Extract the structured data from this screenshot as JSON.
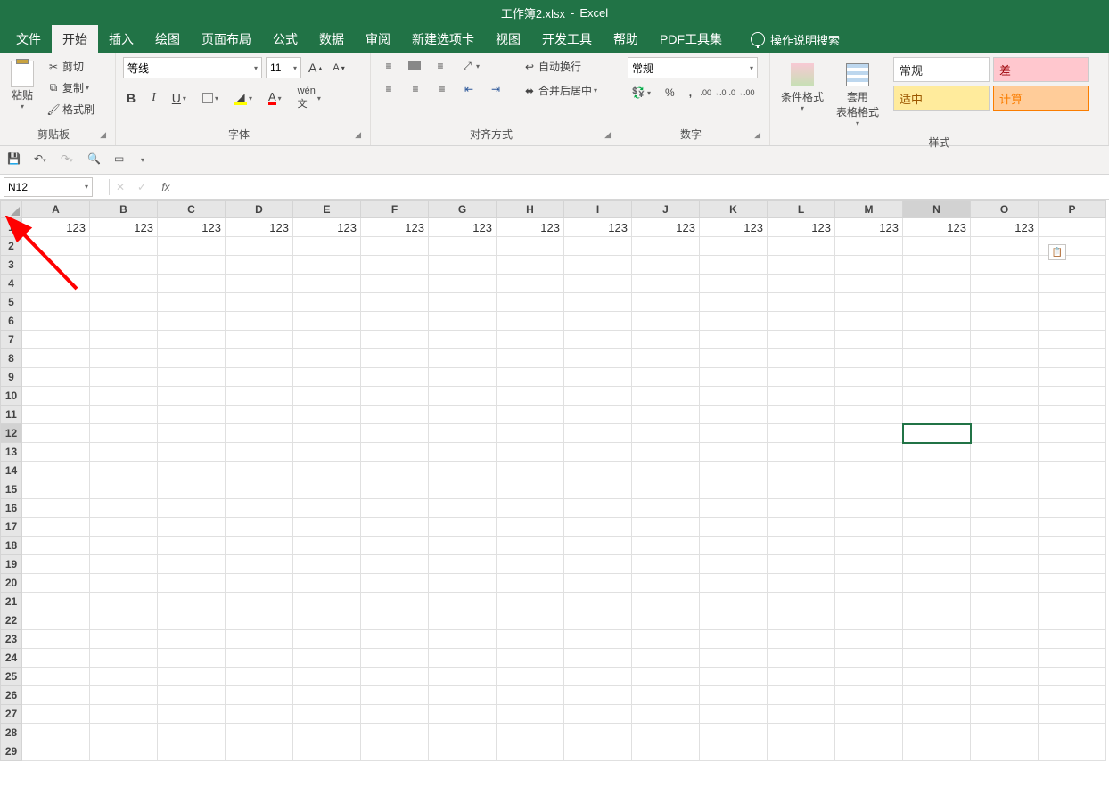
{
  "title": {
    "filename": "工作簿2.xlsx",
    "sep": "-",
    "app": "Excel"
  },
  "tabs": [
    "文件",
    "开始",
    "插入",
    "绘图",
    "页面布局",
    "公式",
    "数据",
    "审阅",
    "新建选项卡",
    "视图",
    "开发工具",
    "帮助",
    "PDF工具集"
  ],
  "active_tab_index": 1,
  "tellme": "操作说明搜索",
  "clipboard": {
    "paste": "粘贴",
    "cut": "剪切",
    "copy": "复制",
    "fmtpaint": "格式刷",
    "group": "剪贴板"
  },
  "font": {
    "name": "等线",
    "size": "11",
    "group": "字体"
  },
  "align": {
    "wrap": "自动换行",
    "merge": "合并后居中",
    "group": "对齐方式"
  },
  "number": {
    "format": "常规",
    "group": "数字"
  },
  "styles": {
    "condfmt": "条件格式",
    "tablefmt": "套用\n表格格式",
    "group": "样式",
    "cells": {
      "normal": "常规",
      "bad": "差",
      "good": "适中",
      "calc": "计算"
    }
  },
  "namebox": "N12",
  "columns": [
    "A",
    "B",
    "C",
    "D",
    "E",
    "F",
    "G",
    "H",
    "I",
    "J",
    "K",
    "L",
    "M",
    "N",
    "O",
    "P"
  ],
  "rows": [
    1,
    2,
    3,
    4,
    5,
    6,
    7,
    8,
    9,
    10,
    11,
    12,
    13,
    14,
    15,
    16,
    17,
    18,
    19,
    20,
    21,
    22,
    23,
    24,
    25,
    26,
    27,
    28,
    29
  ],
  "row1_values": [
    "123",
    "123",
    "123",
    "123",
    "123",
    "123",
    "123",
    "123",
    "123",
    "123",
    "123",
    "123",
    "123",
    "123",
    "123",
    ""
  ],
  "selected": {
    "col": "N",
    "row": 12,
    "colIndex": 13
  }
}
